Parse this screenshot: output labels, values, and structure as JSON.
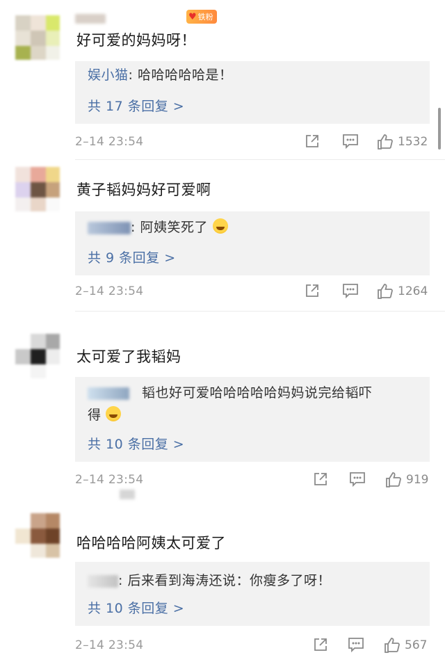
{
  "comments": [
    {
      "text": "好可爱的妈妈呀！",
      "badge": "铁粉",
      "reply_author": "娱小猫",
      "reply_text": ": 哈哈哈哈哈是！",
      "reply_count": "共 17 条回复 >",
      "time": "2–14 23:54",
      "likes": "1532"
    },
    {
      "text": "黄子韬妈妈好可爱啊",
      "reply_text": ": 阿姨笑死了",
      "reply_count": "共 9 条回复 >",
      "time": "2–14 23:54",
      "likes": "1264"
    },
    {
      "text": "太可爱了我韬妈",
      "reply_text": "韬也好可爱哈哈哈哈哈妈妈说完给韬吓",
      "reply_text_2": "得",
      "reply_count": "共 10 条回复 >",
      "time": "2–14 23:54",
      "likes": "919"
    },
    {
      "text": "哈哈哈哈阿姨太可爱了",
      "reply_text": ": 后来看到海涛还说：你瘦多了呀！",
      "reply_count": "共 10 条回复 >",
      "time": "2–14 23:54",
      "likes": "567"
    }
  ],
  "icons": {
    "share": "share-icon",
    "comment": "comment-icon",
    "like": "thumbs-up-icon"
  },
  "colors": {
    "link": "#4a6fa5",
    "reply_bg": "#f2f2f2",
    "meta": "#9a9a9a"
  }
}
